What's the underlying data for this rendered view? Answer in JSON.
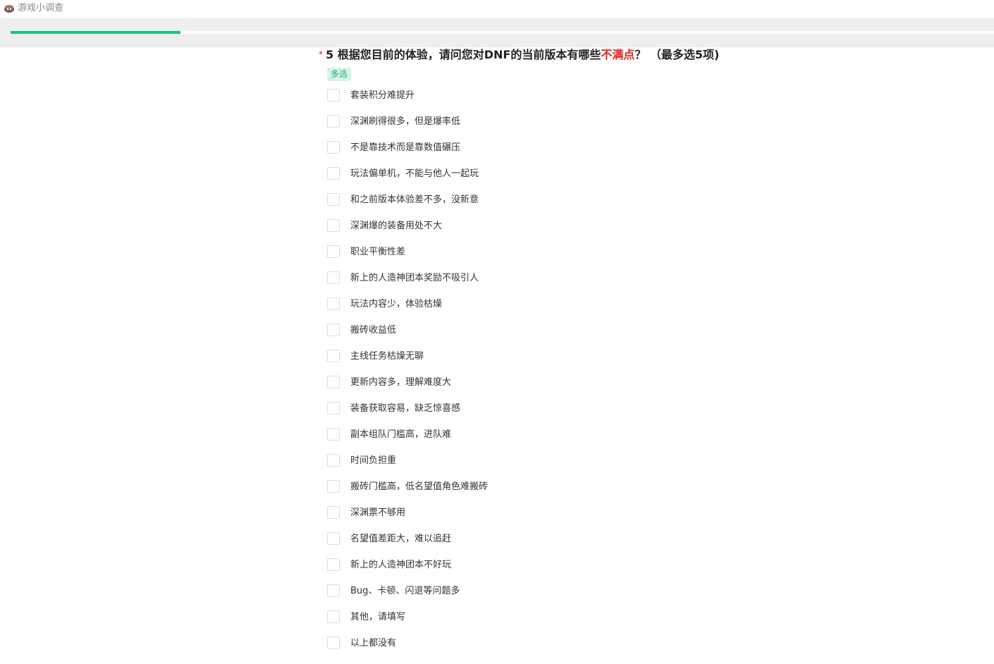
{
  "header": {
    "title": "游戏小调查",
    "icon": "game-avatar-icon"
  },
  "progress": {
    "fraction": 0.173,
    "color": "#1fc17b"
  },
  "question": {
    "required_mark": "*",
    "number": "5",
    "text_before": "根据您目前的体验，请问您对DNF的当前版本有哪些",
    "highlight": "不满点",
    "text_after": "？ （最多选5项)",
    "highlight_color": "#e02020",
    "type_tag": "多选",
    "options": [
      "套装积分难提升",
      "深渊刷得很多，但是爆率低",
      "不是靠技术而是靠数值碾压",
      "玩法偏单机，不能与他人一起玩",
      "和之前版本体验差不多，没新意",
      "深渊爆的装备用处不大",
      "职业平衡性差",
      "新上的人造神团本奖励不吸引人",
      "玩法内容少，体验枯燥",
      "搬砖收益低",
      "主线任务枯燥无聊",
      "更新内容多，理解难度大",
      "装备获取容易，缺乏惊喜感",
      "副本组队门槛高，进队难",
      "时间负担重",
      "搬砖门槛高，低名望值角色难搬砖",
      "深渊票不够用",
      "名望值差距大，难以追赶",
      "新上的人造神团本不好玩",
      "Bug、卡顿、闪退等问题多",
      "其他，请填写",
      "以上都没有"
    ]
  }
}
